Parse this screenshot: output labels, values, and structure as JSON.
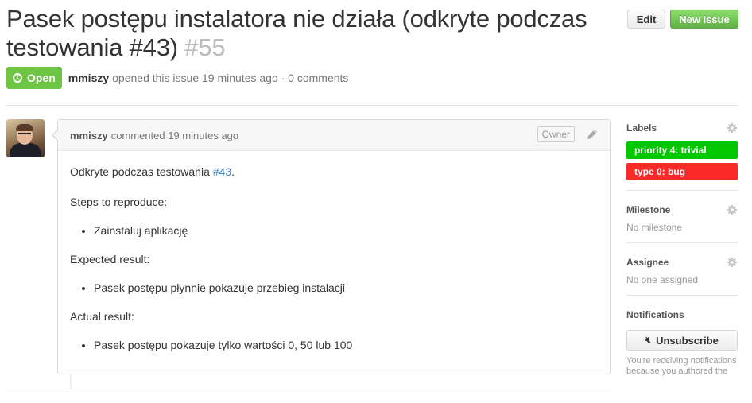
{
  "issue": {
    "title": "Pasek postępu instalatora nie działa (odkryte podczas testowania #43)",
    "number": "#55",
    "state": "Open",
    "author": "mmiszy",
    "opened_text": "opened this issue 19 minutes ago · 0 comments"
  },
  "header": {
    "edit_label": "Edit",
    "new_issue_label": "New Issue"
  },
  "comment": {
    "author": "mmiszy",
    "time_text": "commented 19 minutes ago",
    "owner_badge": "Owner",
    "intro_text": "Odkryte podczas testowania ",
    "intro_link": "#43",
    "intro_end": ".",
    "steps_heading": "Steps to reproduce:",
    "steps": [
      "Zainstaluj aplikację"
    ],
    "expected_heading": "Expected result:",
    "expected": [
      "Pasek postępu płynnie pokazuje przebieg instalacji"
    ],
    "actual_heading": "Actual result:",
    "actual": [
      "Pasek postępu pokazuje tylko wartości 0, 50 lub 100"
    ]
  },
  "sidebar": {
    "labels_title": "Labels",
    "labels": [
      {
        "name": "priority 4: trivial",
        "color": "#02c800"
      },
      {
        "name": "type 0: bug",
        "color": "#fc2929"
      }
    ],
    "milestone_title": "Milestone",
    "milestone_value": "No milestone",
    "assignee_title": "Assignee",
    "assignee_value": "No one assigned",
    "notifications_title": "Notifications",
    "unsubscribe_label": "Unsubscribe",
    "notifications_note": "You're receiving notifications because you authored the"
  },
  "colors": {
    "open_state": "#6cc644",
    "link": "#4183c4",
    "new_issue": "#60b044"
  }
}
